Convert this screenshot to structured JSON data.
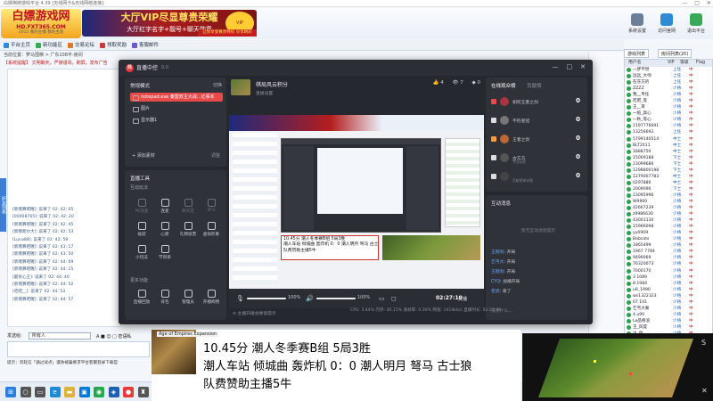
{
  "background_window": {
    "title": "白嫖棋牌游戏平台 4.39 [无线网卡&无线网络连接]",
    "logo": {
      "big": "白嫖游戏网",
      "small": "HD.FXT365.COM",
      "tiny": "2015 我的主播 我的主场"
    },
    "vip_ad": {
      "line1": "大厅VIP尽显尊贵荣耀",
      "line2": "大厅红字名字+靓号+聊天勋章",
      "badge": "VIP"
    },
    "ad2": "让你享受尊贵特权 尽享精彩",
    "top_tools": [
      {
        "label": "系统设置",
        "icon": "gear-icon",
        "color": "#6b7f99"
      },
      {
        "label": "访问官网",
        "icon": "home-icon",
        "color": "#2f8ad6"
      },
      {
        "label": "退出平台",
        "icon": "exit-icon",
        "color": "#39a957"
      }
    ],
    "nav_tabs": [
      {
        "label": "平台主页",
        "color": "#2f8ad6"
      },
      {
        "label": "新功能区",
        "color": "#39a957"
      },
      {
        "label": "交易论坛",
        "color": "#e07a22"
      },
      {
        "label": "领取奖励",
        "color": "#c83a3a"
      },
      {
        "label": "客服邮件",
        "color": "#6a5acd"
      }
    ],
    "breadcrumb": "当前位置：萝马围棋 > 广东108平-房间",
    "notice": "【系统提醒】 文明聊天，严禁谩骂，刷屏，发布广告",
    "side_strip": "好友列表",
    "chat_lines": [
      "[新增算吧喔]: 说来了 02: 42: 05",
      "[00008765]: 说来了 02: 42: 20",
      "[新增算吧喔]: 说来了 02: 42: 45",
      "[新增新尔大]: 说来了 02: 42: 53",
      "[Luna88]: 说来了 02: 42: 59",
      "[新增算吧喔]: 说来了 02: 43: 17",
      "[新增算吧喔]: 说来了 02: 43: 50",
      "[新增算吧喔]: 说来了 02: 44: 09",
      "[新增算吧喔]: 说来了 02: 44: 15",
      "[最优心王]: 说来了 02: 44: 40",
      "[新增算吧喔]: 说来了 02: 44: 52",
      "[吃吧__]: 说来了 02: 44: 53",
      "[新增算吧喔]: 说来了 02: 44: 57"
    ],
    "chat_input": {
      "label": "发送给:",
      "target": "所有人",
      "format": "A  ■  ☺  □ 密语私",
      "send": "发送"
    },
    "tip": "提示：勿轻信「通过试点」谨防被骗要求平台客服登录下载官",
    "right_tabs": [
      "游戏列表",
      "房间列表(20)"
    ],
    "user_list_headers": [
      "用户名",
      "VIP",
      "等级",
      "Flag"
    ],
    "users": [
      [
        "一梦不觉",
        "上任",
        "中"
      ],
      [
        "远远_大师",
        "上任",
        "中"
      ],
      [
        "在东方的",
        "上任",
        "中"
      ],
      [
        "ZZZZ",
        "少将",
        "中"
      ],
      [
        "我__专任",
        "少将",
        "中"
      ],
      [
        "吃吧_等",
        "少将",
        "中"
      ],
      [
        "王__哥",
        "少将",
        "中"
      ],
      [
        "一纸_冥心",
        "少将",
        "中"
      ],
      [
        "一秋_等心",
        "少将",
        "中"
      ],
      [
        "1197776691",
        "少将",
        "中"
      ],
      [
        "13256692",
        "上任",
        "中"
      ],
      [
        "5799140514",
        "中士",
        "中"
      ],
      [
        "BLT2011",
        "中士",
        "中"
      ],
      [
        "1888750",
        "中士",
        "中"
      ],
      [
        "15009188",
        "下士",
        "中"
      ],
      [
        "23099686",
        "下士",
        "中"
      ],
      [
        "1298800198",
        "下士",
        "中"
      ],
      [
        "1279007783",
        "中士",
        "中"
      ],
      [
        "0297880",
        "中士",
        "中"
      ],
      [
        "2009090",
        "下士",
        "中"
      ],
      [
        "23095996",
        "少将",
        "中"
      ],
      [
        "W9900",
        "少将",
        "中"
      ],
      [
        "42667239",
        "少将",
        "中"
      ],
      [
        "z9986630",
        "少将",
        "中"
      ],
      [
        "43001130",
        "少将",
        "中"
      ],
      [
        "15966098",
        "少将",
        "中"
      ],
      [
        "yy0909",
        "少将",
        "中"
      ],
      [
        "Bobcats",
        "少将",
        "中"
      ],
      [
        "1865499",
        "少将",
        "中"
      ],
      [
        "1967 7784",
        "少将",
        "中"
      ],
      [
        "9499069",
        "少将",
        "中"
      ],
      [
        "76320073",
        "少将",
        "中"
      ],
      [
        "7000170",
        "少将",
        "中"
      ],
      [
        "3 1089",
        "少将",
        "中"
      ],
      [
        "8 1984",
        "少将",
        "中"
      ],
      [
        "u9_1990",
        "少将",
        "中"
      ],
      [
        "ws1322323",
        "少将",
        "中"
      ],
      [
        "67 101",
        "少将",
        "中"
      ],
      [
        "乞丐大秦",
        "少将",
        "中"
      ],
      [
        "4 u90",
        "少将",
        "中"
      ],
      [
        "Le品格浪",
        "少将",
        "中"
      ],
      [
        "王_风度",
        "少将",
        "中"
      ],
      [
        "冷_你",
        "少将",
        "中"
      ],
      [
        "8 Acer",
        "少将",
        "中"
      ],
      [
        "8 Adam",
        "少将",
        "中"
      ],
      [
        "8 Acer",
        "少将",
        "中"
      ]
    ]
  },
  "stream_app": {
    "name": "直播中控",
    "version": "0.0",
    "window_controls": [
      "—",
      "□",
      "✕"
    ],
    "scene_card": {
      "title": "常规模式",
      "action": "切换",
      "scenes": [
        "notepad.exe 秦盟双主大战...记事本",
        "图片",
        "显示器1"
      ],
      "add": "+ 添加素材",
      "sub": "调整"
    },
    "tools_card": {
      "title": "直播工具",
      "subtitle": "互动玩法",
      "items": [
        {
          "label": "PK连麦",
          "dim": true
        },
        {
          "label": "连麦",
          "dim": false
        },
        {
          "label": "聊天室",
          "dim": true
        },
        {
          "label": "KTV",
          "dim": true
        },
        {
          "label": "福袋",
          "dim": false
        },
        {
          "label": "心愿",
          "dim": false
        },
        {
          "label": "礼物投票",
          "dim": false
        },
        {
          "label": "虚拟形象",
          "dim": false
        },
        {
          "label": "小玩法",
          "dim": false
        },
        {
          "label": "节目单",
          "dim": false
        }
      ],
      "more_title": "更多功能",
      "more": [
        {
          "label": "直播回放"
        },
        {
          "label": "背包"
        },
        {
          "label": "管理员"
        },
        {
          "label": "开播购物"
        }
      ]
    },
    "room": {
      "title": "棋局风云积分",
      "subtitle": "直播设置",
      "stats": [
        "👍 4",
        "👁 7",
        "◆ 0"
      ],
      "owner": "萝马围棋的主播"
    },
    "preview_ticker": "10.45分 潮人冬季赛B组 5局3胜\n潮人车站 倾城曲 轰炸机 0：0 潮人明月 弩马 古士狼\n队费赞助主播5牛",
    "preview_bar": {
      "mic_pct": "100%",
      "mic_level": 1.0,
      "speaker_pct": "100%",
      "speaker_level": 1.0,
      "time": "02:27:10",
      "live_label": "关播"
    },
    "preview_hint": "⊘ 主播开播会弹窗提示",
    "status": "CPU: 3.44%   内存: 40.15%   丢帧率: 0.00%   网速: 1419kb/s   直播时长: 02:27:09",
    "audience_card": {
      "tabs": [
        "在线观众榜",
        "贡献榜"
      ],
      "rows": [
        {
          "name": "如何王者之剑",
          "sub": "",
          "value": "0",
          "color": "#e84a4a",
          "avatar": "#a34"
        },
        {
          "name": "不朽星冠",
          "sub": "",
          "value": "0",
          "color": "#ddd",
          "avatar": "#777"
        },
        {
          "name": "王者之剑",
          "sub": "",
          "value": "0",
          "color": "#ff9a3a",
          "avatar": "#b63"
        },
        {
          "name": "古方方",
          "sub": "专业玩家",
          "value": "0",
          "color": "#ddd",
          "avatar": "#555"
        },
        {
          "name": "",
          "sub": "贡献榜单详情",
          "value": "0",
          "color": "#ddd",
          "avatar": "#444"
        }
      ]
    },
    "im_card": {
      "title": "互动消息",
      "empty": "暂无互动消息提示",
      "lines": [
        {
          "user": "王刚剑",
          "text": "开局"
        },
        {
          "user": "乞丐大",
          "text": "开局"
        },
        {
          "user": "王刚剑",
          "text": "开局"
        },
        {
          "user": "CYQ",
          "text": "加播开局"
        },
        {
          "user": "老虎",
          "text": "来了"
        }
      ],
      "input_placeholder": "说点什么..."
    }
  },
  "overlay": {
    "app_label": "Age of Empires Expansion",
    "line1": "10.45分          潮人冬季赛B组               5局3胜",
    "line2": "潮人车站 倾城曲 轰炸机 0：0 潮人明月 弩马 古士狼",
    "line3": "队费赞助主播5牛"
  },
  "taskbar": {
    "icons": [
      {
        "name": "start-icon",
        "glyph": "⊞",
        "color": "#2a7de1"
      },
      {
        "name": "search-icon",
        "glyph": "○",
        "color": "#555"
      },
      {
        "name": "taskview-icon",
        "glyph": "▭",
        "color": "#555"
      },
      {
        "name": "edge-icon",
        "glyph": "e",
        "color": "#1e8ad3"
      },
      {
        "name": "folder-icon",
        "glyph": "▬",
        "color": "#e0b23a"
      },
      {
        "name": "store-icon",
        "glyph": "▣",
        "color": "#0078d4"
      },
      {
        "name": "app-green-icon",
        "glyph": "◉",
        "color": "#29a64a"
      },
      {
        "name": "app-blue-icon",
        "glyph": "◈",
        "color": "#1e5fb4"
      },
      {
        "name": "stream-app-icon",
        "glyph": "●",
        "color": "#e83a3a"
      },
      {
        "name": "game-app-icon",
        "glyph": "♜",
        "color": "#555"
      }
    ]
  }
}
